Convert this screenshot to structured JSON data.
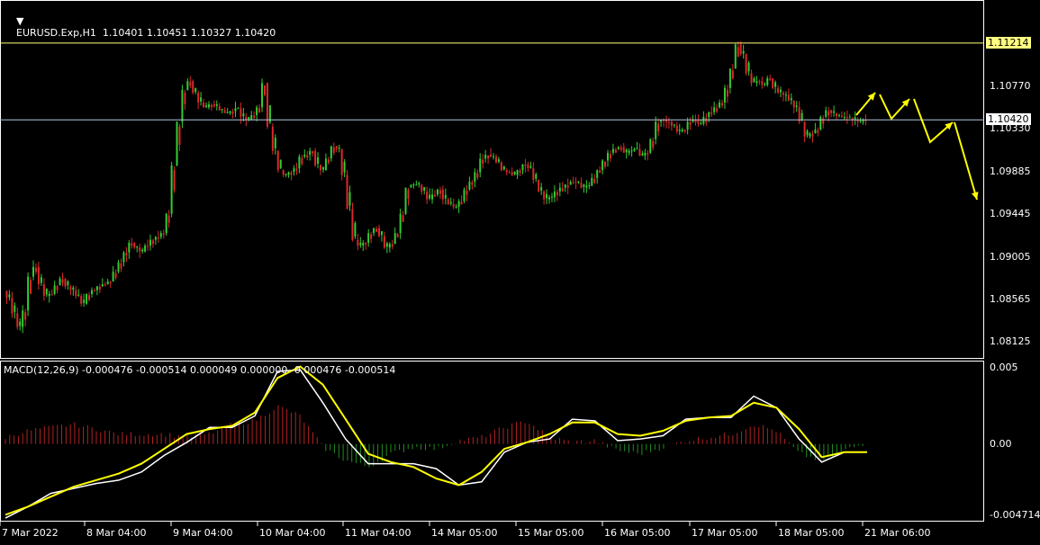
{
  "header": {
    "symbol_line": "EURUSD.Exp,H1  1.10401 1.10451 1.10327 1.10420",
    "macd_line": "MACD(12,26,9) -0.000476 -0.000514 0.000049 0.000000 -0.000476 -0.000514"
  },
  "colors": {
    "background": "#000000",
    "bull": "#32CD32",
    "bear": "#DC2828",
    "frame": "#FFFFFF",
    "hline_high": "#FFFF80",
    "hline_bid": "#B0C4DE",
    "arrow": "#FFFF00",
    "macd_main": "#FFFFFF",
    "macd_signal": "#FFFF00",
    "hist_pos": "#B22222",
    "hist_neg": "#228B22"
  },
  "chart_data": [
    {
      "type": "candlestick",
      "name": "price",
      "ylim": [
        1.0795,
        1.1165
      ],
      "yticks": [
        "1.10770",
        "1.10330",
        "1.09885",
        "1.09445",
        "1.09005",
        "1.08565",
        "1.08125"
      ],
      "xticks": [
        "7 Mar 2022",
        "8 Mar 04:00",
        "9 Mar 04:00",
        "10 Mar 04:00",
        "11 Mar 04:00",
        "14 Mar 05:00",
        "15 Mar 05:00",
        "16 Mar 05:00",
        "17 Mar 05:00",
        "18 Mar 05:00",
        "21 Mar 06:00"
      ],
      "hlines": [
        {
          "value": 1.11214,
          "label": "1.11214",
          "style": "high"
        },
        {
          "value": 1.1042,
          "label": "1.10420",
          "style": "bid"
        }
      ],
      "close_path": [
        1.0865,
        1.0858,
        1.0842,
        1.0828,
        1.0845,
        1.088,
        1.089,
        1.0872,
        1.086,
        1.0862,
        1.0871,
        1.0878,
        1.087,
        1.0866,
        1.086,
        1.0852,
        1.0862,
        1.0866,
        1.087,
        1.0872,
        1.0875,
        1.0885,
        1.0895,
        1.0905,
        1.0915,
        1.091,
        1.0906,
        1.0912,
        1.0918,
        1.0921,
        1.0925,
        1.0945,
        1.0995,
        1.104,
        1.1073,
        1.1082,
        1.107,
        1.106,
        1.1055,
        1.1058,
        1.1056,
        1.1052,
        1.1049,
        1.1051,
        1.1054,
        1.1045,
        1.1042,
        1.1047,
        1.1055,
        1.108,
        1.1035,
        1.101,
        1.099,
        1.0985,
        1.0988,
        1.0992,
        1.1004,
        1.1006,
        1.101,
        1.0995,
        1.099,
        1.1002,
        1.1015,
        1.1012,
        1.0985,
        1.095,
        1.0918,
        1.0912,
        1.0915,
        1.0925,
        1.093,
        1.0922,
        1.091,
        1.0914,
        1.0925,
        1.0945,
        1.0972,
        1.0975,
        1.0975,
        1.0968,
        1.096,
        1.0965,
        1.097,
        1.096,
        1.0955,
        1.0952,
        1.0958,
        1.097,
        1.0978,
        1.0988,
        1.1002,
        1.1006,
        1.1004,
        1.0998,
        1.099,
        1.0988,
        1.0985,
        1.099,
        1.0996,
        1.0992,
        1.098,
        1.0968,
        1.096,
        1.0962,
        1.0968,
        1.0972,
        1.0975,
        1.0978,
        1.0977,
        1.0972,
        1.0974,
        1.0982,
        1.099,
        1.1,
        1.1008,
        1.1012,
        1.1014,
        1.1008,
        1.101,
        1.1012,
        1.1005,
        1.1008,
        1.1022,
        1.104,
        1.1042,
        1.104,
        1.1036,
        1.103,
        1.1032,
        1.104,
        1.1042,
        1.1038,
        1.1045,
        1.105,
        1.1055,
        1.106,
        1.1075,
        1.1095,
        1.112,
        1.111,
        1.109,
        1.108,
        1.1082,
        1.1078,
        1.1085,
        1.1075,
        1.107,
        1.1068,
        1.1062,
        1.1055,
        1.104,
        1.1025,
        1.1028,
        1.1032,
        1.1045,
        1.1052,
        1.1049,
        1.1046,
        1.1045,
        1.1044,
        1.1042,
        1.104,
        1.1042
      ],
      "projection_arrows": [
        [
          [
            951,
            128
          ],
          [
            972,
            103
          ]
        ],
        [
          [
            977,
            105
          ],
          [
            990,
            132
          ],
          [
            1010,
            110
          ]
        ],
        [
          [
            1015,
            110
          ],
          [
            1033,
            158
          ],
          [
            1058,
            136
          ]
        ],
        [
          [
            1060,
            136
          ],
          [
            1085,
            222
          ]
        ]
      ]
    },
    {
      "type": "line",
      "name": "MACD(12,26,9)",
      "ylim": [
        -0.004714,
        0.005
      ],
      "yticks": [
        "0.005",
        "0.00",
        "-0.004714"
      ],
      "series": [
        {
          "role": "main",
          "values": [
            -0.0045,
            -0.0038,
            -0.003,
            -0.0027,
            -0.0024,
            -0.0022,
            -0.0017,
            -0.0007,
            0.0001,
            0.001,
            0.001,
            0.0017,
            0.0044,
            0.0045,
            0.0025,
            0.0003,
            -0.0012,
            -0.0012,
            -0.0012,
            -0.0015,
            -0.0025,
            -0.0023,
            -0.0005,
            0.0001,
            0.0003,
            0.0015,
            0.0014,
            0.0002,
            0.0003,
            0.0005,
            0.0015,
            0.0016,
            0.0016,
            0.0029,
            0.0022,
            0.0003,
            -0.0011,
            -0.0005,
            -0.0005
          ]
        },
        {
          "role": "signal",
          "values": [
            -0.0043,
            -0.0038,
            -0.0032,
            -0.0026,
            -0.0022,
            -0.0018,
            -0.0012,
            -0.0003,
            0.0006,
            0.0009,
            0.0011,
            0.0019,
            0.004,
            0.0047,
            0.0036,
            0.0015,
            -0.0006,
            -0.0011,
            -0.0014,
            -0.0021,
            -0.0025,
            -0.0017,
            -0.0003,
            0.0001,
            0.0006,
            0.0013,
            0.0013,
            0.0006,
            0.0005,
            0.0008,
            0.0014,
            0.0016,
            0.0017,
            0.0025,
            0.0022,
            0.0009,
            -0.0008,
            -0.0005,
            -0.0005
          ]
        }
      ],
      "histogram_estimate": [
        0.0004,
        0.0008,
        0.001,
        0.0012,
        0.0009,
        0.0006,
        0.0006,
        0.0006,
        0.0004,
        0.0006,
        0.0012,
        0.0014,
        0.0023,
        0.0017,
        -0.0002,
        -0.001,
        -0.0014,
        -0.0006,
        -0.0002,
        -0.0003,
        0.0002,
        0.0004,
        0.001,
        0.0014,
        0.0004,
        0.0001,
        0.0002,
        -0.0004,
        -0.0006,
        -0.0002,
        0.0002,
        0.0004,
        0.0006,
        0.0012,
        0.0008,
        -0.0006,
        -0.001,
        -0.0004,
        0.0001
      ]
    }
  ]
}
